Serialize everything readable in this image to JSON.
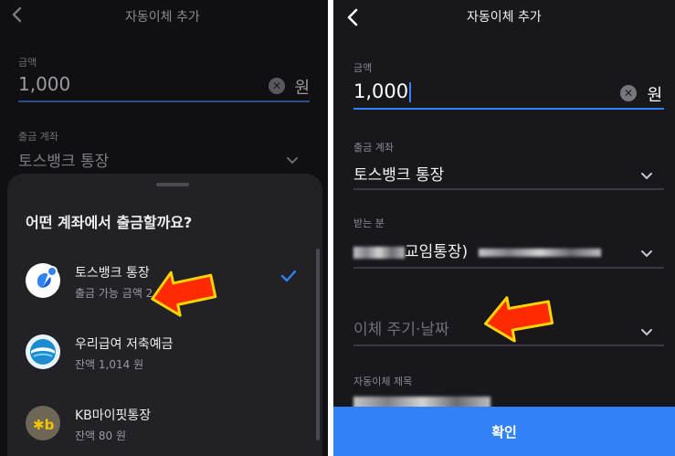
{
  "left": {
    "header": {
      "title": "자동이체 추가"
    },
    "amount": {
      "label": "금액",
      "value": "1,000",
      "unit": "원"
    },
    "account": {
      "label": "출금 계좌",
      "value": "토스뱅크 통장"
    },
    "sheet": {
      "title": "어떤 계좌에서 출금할까요?",
      "items": [
        {
          "name": "토스뱅크 통장",
          "sub": "출금 가능 금액 2",
          "selected": true
        },
        {
          "name": "우리급여 저축예금",
          "sub": "잔액 1,014 원",
          "selected": false
        },
        {
          "name": "KB마이핏통장",
          "sub": "잔액 80 원",
          "selected": false
        }
      ]
    }
  },
  "right": {
    "header": {
      "title": "자동이체 추가"
    },
    "amount": {
      "label": "금액",
      "value": "1,000",
      "unit": "원"
    },
    "account": {
      "label": "출금 계좌",
      "value": "토스뱅크 통장"
    },
    "recipient": {
      "label": "받는 분",
      "value": "교임통장)"
    },
    "schedule": {
      "placeholder": "이체 주기·날짜"
    },
    "memo": {
      "label": "자동이체 제목"
    },
    "confirm_label": "확인"
  },
  "colors": {
    "accent": "#3182f6",
    "arrow": "#ff2a00",
    "arrow_outline": "#ffd400"
  }
}
